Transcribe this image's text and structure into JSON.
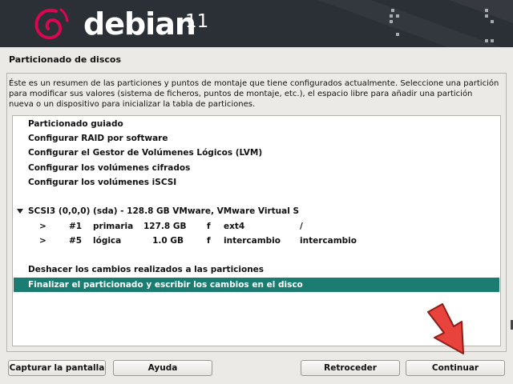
{
  "banner": {
    "brand": "debian",
    "version": "11"
  },
  "title": "Particionado de discos",
  "description": "Éste es un resumen de las particiones y puntos de montaje que tiene configurados actualmente. Seleccione una partición para modificar sus valores (sistema de ficheros, puntos de montaje, etc.), el espacio libre para añadir una partición nueva o un dispositivo para inicializar la tabla de particiones.",
  "menu": [
    "Particionado guiado",
    "Configurar RAID por software",
    "Configurar el Gestor de Volúmenes Lógicos (LVM)",
    "Configurar los volúmenes cifrados",
    "Configurar los volúmenes iSCSI"
  ],
  "disk": {
    "label": "SCSI3 (0,0,0) (sda) - 128.8 GB VMware, VMware Virtual S",
    "partitions": [
      {
        "arrow": ">",
        "num": "#1",
        "type": "primaria",
        "size": "127.8 GB",
        "flag": "f",
        "fs": "ext4",
        "mount": "/"
      },
      {
        "arrow": ">",
        "num": "#5",
        "type": "lógica",
        "size": "1.0 GB",
        "flag": "f",
        "fs": "intercambio",
        "mount": "intercambio"
      }
    ]
  },
  "actions": {
    "undo": "Deshacer los cambios realizados a las particiones",
    "finish": "Finalizar el particionado y escribir los cambios en el disco"
  },
  "buttons": {
    "screenshot": "Capturar la pantalla",
    "help": "Ayuda",
    "back": "Retroceder",
    "continue": "Continuar"
  },
  "colors": {
    "banner_bg": "#2b2f36",
    "selection": "#1b7d71",
    "swirl": "#d70751",
    "annotation_arrow": "#e8433d"
  },
  "icons": {
    "logo": "debian-swirl-icon",
    "expand": "triangle-down-icon",
    "annotation": "red-arrow-icon"
  }
}
